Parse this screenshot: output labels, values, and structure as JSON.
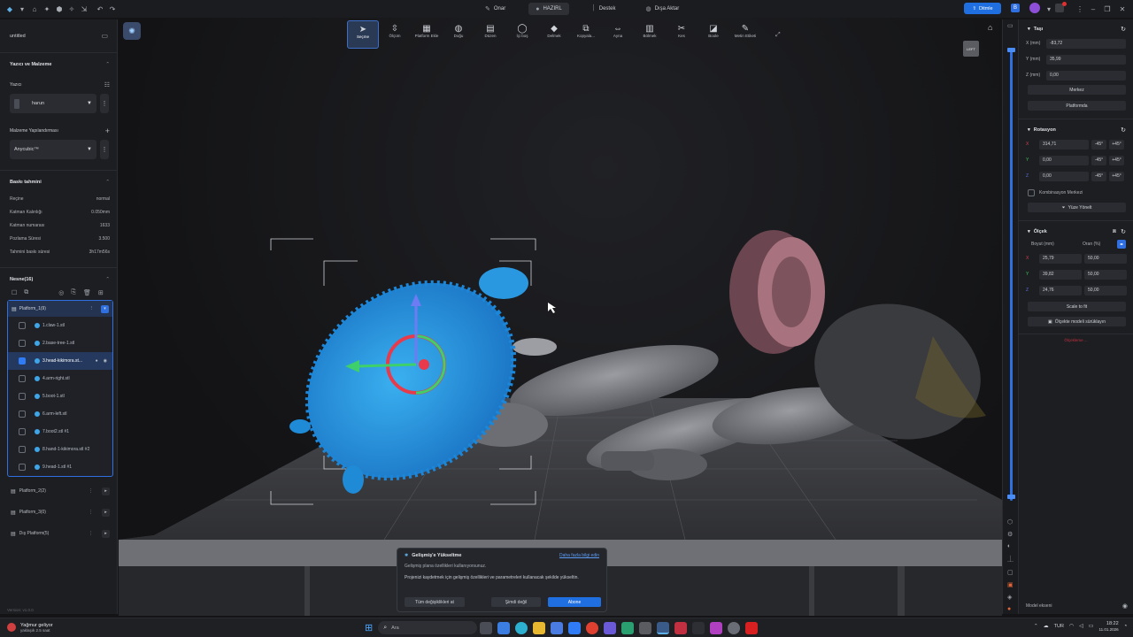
{
  "titlebar": {
    "tabs": [
      {
        "label": "Onar",
        "icon": "wrench-icon"
      },
      {
        "label": "HAZIRL",
        "icon": "prepare-icon",
        "active": true
      },
      {
        "label": "Destek",
        "icon": "support-icon"
      },
      {
        "label": "Dışa Aktar",
        "icon": "export-icon"
      }
    ],
    "upgrade_label": "Ditmle"
  },
  "sidebar": {
    "file_name": "untitled",
    "printer_section": "Yazıcı ve Malzeme",
    "printer_label": "Yazıcı",
    "printer_value": "harun",
    "material_label": "Malzeme Yapılandırması",
    "material_value": "Anycubic™",
    "estimate_section": "Baskı tahmini",
    "estimates": [
      {
        "label": "Reçine",
        "value": "normal"
      },
      {
        "label": "Katman Kalınlığı",
        "value": "0.050mm"
      },
      {
        "label": "Katman numarası",
        "value": "1633"
      },
      {
        "label": "Pozlama Süresi",
        "value": "3.500"
      },
      {
        "label": "Tahmini baskı süresi",
        "value": "3h17m56s"
      }
    ],
    "objects_section": "Nesne(16)",
    "platform1": "Platform_1(9)",
    "objects": [
      {
        "name": "1.claw-1.stl",
        "checked": false
      },
      {
        "name": "2.base-tree-1.stl",
        "checked": false
      },
      {
        "name": "3.head-kikimora.st...",
        "checked": true
      },
      {
        "name": "4.arm-right.stl",
        "checked": false
      },
      {
        "name": "5.boot-1.stl",
        "checked": false
      },
      {
        "name": "6.arm-left.stl",
        "checked": false
      },
      {
        "name": "7.boot2.stl #1",
        "checked": false
      },
      {
        "name": "8.hand-1-kikimora.stl #2",
        "checked": false
      },
      {
        "name": "9.head-1.stl #1",
        "checked": false
      }
    ],
    "platforms": [
      "Platform_2(2)",
      "Platform_3(0)",
      "Dış Platform(5)"
    ],
    "version": "Version: v1.0.0"
  },
  "toolbar": {
    "tools": [
      {
        "label": "Seçme",
        "icon": "cursor-icon",
        "active": true
      },
      {
        "label": "Ölçüm",
        "icon": "measure-icon"
      },
      {
        "label": "Platform Ekle",
        "icon": "add-platform-icon"
      },
      {
        "label": "Doğu",
        "icon": "orient-icon"
      },
      {
        "label": "Düzen",
        "icon": "layout-icon"
      },
      {
        "label": "İçi boş",
        "icon": "hollow-icon"
      },
      {
        "label": "Delmek",
        "icon": "drill-icon"
      },
      {
        "label": "Kopyala...",
        "icon": "copy-icon"
      },
      {
        "label": "Ayna",
        "icon": "mirror-icon"
      },
      {
        "label": "Bölmek",
        "icon": "split-icon"
      },
      {
        "label": "Kes",
        "icon": "cut-icon"
      },
      {
        "label": "Boole",
        "icon": "boolean-icon"
      },
      {
        "label": "Metin Etiketi",
        "icon": "text-label-icon"
      }
    ],
    "view_cube": "LEFT"
  },
  "rpanel": {
    "move_section": "Taşı",
    "x_label": "X (mm)",
    "x_value": "-83,72",
    "y_label": "Y (mm)",
    "y_value": "35,99",
    "z_label": "Z (mm)",
    "z_value": "0,00",
    "center_btn": "Merkez",
    "platform_btn": "Platformda",
    "rotation_section": "Rotasyon",
    "rot": [
      {
        "axis": "X",
        "value": "314,71"
      },
      {
        "axis": "Y",
        "value": "0,00"
      },
      {
        "axis": "Z",
        "value": "0,00"
      }
    ],
    "minus45": "-45°",
    "plus45": "+45°",
    "combo_center": "Kombinasyon Merkezi",
    "face_align": "Yüze Yönelt",
    "scale_section": "Ölçek",
    "size_label": "Boyut (mm)",
    "ratio_label": "Oran (%)",
    "scale": [
      {
        "axis": "X",
        "size": "25,79",
        "ratio": "50,00"
      },
      {
        "axis": "Y",
        "size": "39,82",
        "ratio": "50,00"
      },
      {
        "axis": "Z",
        "size": "24,76",
        "ratio": "50,00"
      }
    ],
    "scale_to_fit": "Scale to fit",
    "scale_model": "Ölçekte modeli sürüklayın",
    "red_note": "Ölçekleme ...",
    "model_axis": "Model ekseni"
  },
  "popup": {
    "title": "Gelişmiş'e Yükseltme",
    "link": "Daha fazla bilgi edin",
    "line1": "Gelişmiş plana özellikleri kullanıyorsunuz.",
    "line2": "Projenizi kaydetmek için gelişmiş özellikleri ve parametreleri kullanacak şekilde yükseltin.",
    "btn_revert": "Tüm değişiklikleri at",
    "btn_later": "Şimdi değil",
    "btn_subscribe": "Abone"
  },
  "taskbar": {
    "weather_title": "Yağmur geliyor",
    "weather_sub": "yaklaşık 2.5 saat",
    "search_placeholder": "Ara",
    "lang": "TUR",
    "time": "18:22",
    "date": "11.01.2026"
  }
}
